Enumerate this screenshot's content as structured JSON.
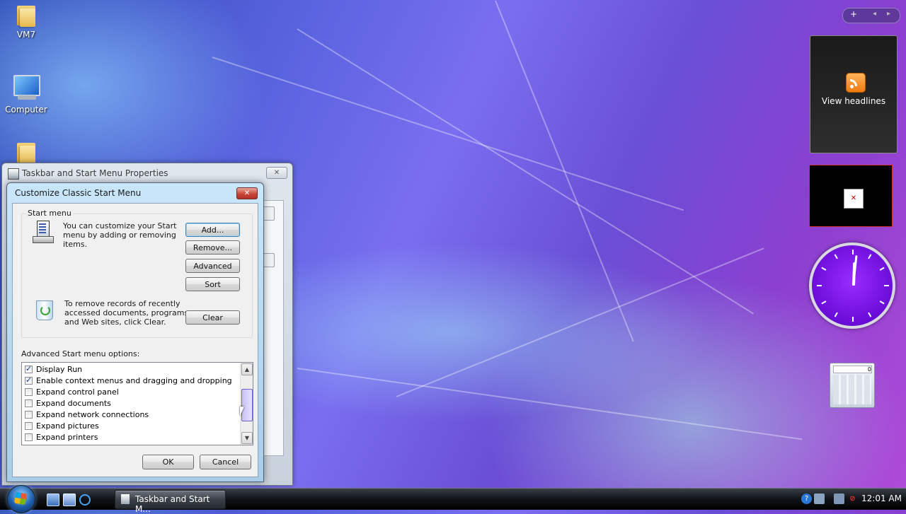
{
  "desktop": {
    "icons": [
      {
        "label": "VM7",
        "icon": "folder-icon"
      },
      {
        "label": "Computer",
        "icon": "computer-icon"
      },
      {
        "label": "",
        "icon": "folder-icon"
      }
    ]
  },
  "parent_window": {
    "title": "Taskbar and Start Menu Properties"
  },
  "dialog": {
    "title": "Customize Classic Start Menu",
    "start_menu_group": "Start menu",
    "customize_text": [
      "You can customize your Start",
      "menu by adding or removing",
      "items."
    ],
    "buttons": {
      "add": "Add...",
      "remove": "Remove...",
      "advanced": "Advanced",
      "sort": "Sort",
      "clear": "Clear"
    },
    "clear_text": [
      "To remove records of recently",
      "accessed documents, programs,",
      "and Web sites, click Clear."
    ],
    "options_label": "Advanced Start menu options:",
    "options": [
      {
        "label": "Display Run",
        "checked": true
      },
      {
        "label": "Enable context menus and dragging and dropping",
        "checked": true
      },
      {
        "label": "Expand control panel",
        "checked": false
      },
      {
        "label": "Expand documents",
        "checked": false
      },
      {
        "label": "Expand network connections",
        "checked": false
      },
      {
        "label": "Expand pictures",
        "checked": false
      },
      {
        "label": "Expand printers",
        "checked": false
      }
    ],
    "ok": "OK",
    "cancel": "Cancel"
  },
  "gadgets": {
    "toolbar_add": "+",
    "feed_label": "View headlines",
    "calculator_display": "0"
  },
  "taskbar": {
    "task_button": "Taskbar and Start M...",
    "time": "12:01 AM"
  },
  "colors": {
    "accent": "#6a0cd8",
    "taskbar": "#101317"
  }
}
